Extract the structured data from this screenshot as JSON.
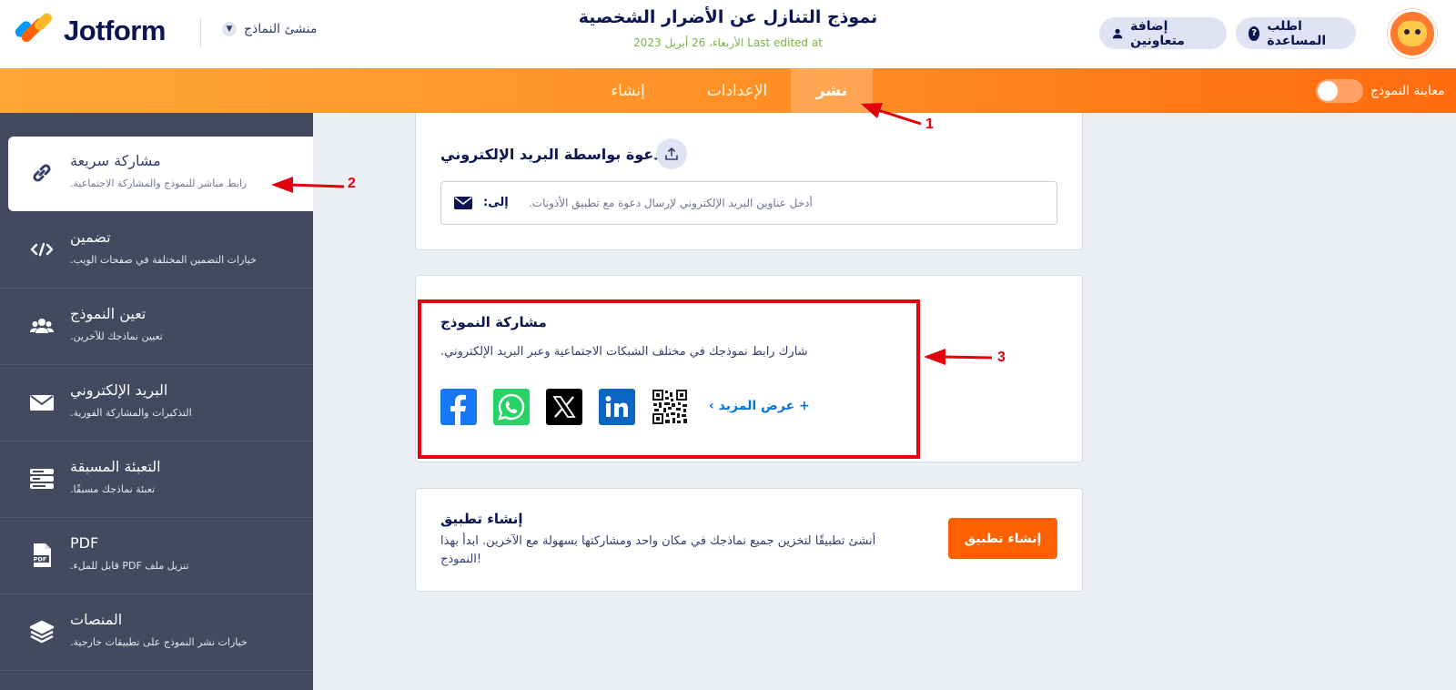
{
  "header": {
    "brand": "Jotform",
    "builder_label": "منشئ النماذج",
    "form_title": "نموذج التنازل عن الأضرار الشخصية",
    "last_edited": "الأربعاء، 26 أبريل 2023 Last edited at",
    "collab_label": "إضافة متعاونين",
    "help_label": "اطلب المساعدة"
  },
  "nav": {
    "create": "إنشاء",
    "settings": "الإعدادات",
    "publish": "نشر",
    "preview": "معاينة النموذج"
  },
  "sidebar": {
    "items": [
      {
        "title": "مشاركة سريعة",
        "desc": ".رابط مباشر للنموذج والمشاركة الاجتماعية",
        "icon": "link-icon"
      },
      {
        "title": "تضمين",
        "desc": ".خيارات التضمين المختلفة في صفحات الويب",
        "icon": "code-icon"
      },
      {
        "title": "تعين النموذج",
        "desc": ".تعيين نماذجك للآخرين",
        "icon": "users-icon"
      },
      {
        "title": "البريد الإلكتروني",
        "desc": ".التذكيرات والمشاركة الفورية",
        "icon": "envelope-icon"
      },
      {
        "title": "التعبئة المسبقة",
        "desc": ".تعبئة نماذجك مسبقًا",
        "icon": "prefill-icon"
      },
      {
        "title": "PDF",
        "desc": ".قابل للملء PDF تنزيل ملف",
        "icon": "pdf-icon"
      },
      {
        "title": "المنصات",
        "desc": ".خيارات نشر النموذج على تطبيقات خارجية",
        "icon": "layers-icon"
      }
    ]
  },
  "invite": {
    "title": "دعوة بواسطة البريد الإلكتروني",
    "to_label": ":إلى",
    "placeholder": ".أدخل عناوين البريد الإلكتروني لإرسال دعوة مع تطبيق الأذونات"
  },
  "share": {
    "title": "مشاركة النموذج",
    "desc": ".شارك رابط نموذجك في مختلف الشبكات الاجتماعية وعبر البريد الإلكتروني",
    "more": "عرض المزيد",
    "icons": [
      "facebook-icon",
      "whatsapp-icon",
      "x-icon",
      "linkedin-icon",
      "qr-code-icon"
    ]
  },
  "app": {
    "title": "إنشاء تطبيق",
    "desc": "أنشئ تطبيقًا لتخزين جميع نماذجك في مكان واحد ومشاركتها بسهولة مع الآخرين. ابدأ بهذا النموذج!",
    "button": "إنشاء تطبيق"
  },
  "annotations": {
    "n1": "1",
    "n2": "2",
    "n3": "3"
  },
  "colors": {
    "accent": "#ff6100",
    "annotation": "#e3000f",
    "sidebar": "#434a5f",
    "link": "#0075e3"
  }
}
